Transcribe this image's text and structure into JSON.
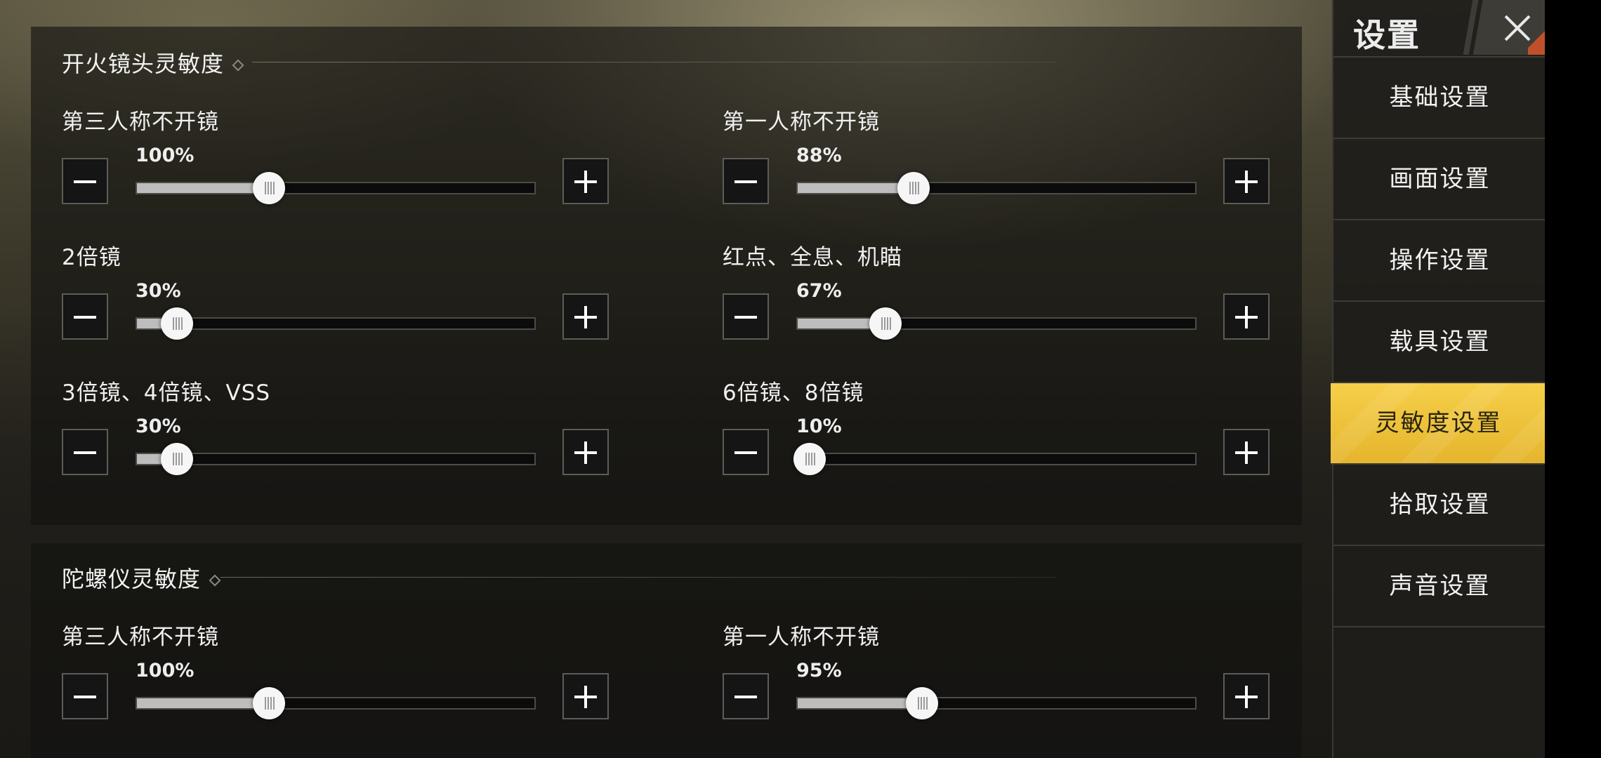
{
  "sidebar": {
    "title": "设置",
    "items": [
      {
        "label": "基础设置",
        "active": false
      },
      {
        "label": "画面设置",
        "active": false
      },
      {
        "label": "操作设置",
        "active": false
      },
      {
        "label": "载具设置",
        "active": false
      },
      {
        "label": "灵敏度设置",
        "active": true
      },
      {
        "label": "拾取设置",
        "active": false
      },
      {
        "label": "声音设置",
        "active": false
      }
    ]
  },
  "fire_scope": {
    "title": "开火镜头灵敏度",
    "controls": [
      {
        "label": "第三人称不开镜",
        "value_text": "100%",
        "level": 0.33
      },
      {
        "label": "第一人称不开镜",
        "value_text": "88%",
        "level": 0.29
      },
      {
        "label": "2倍镜",
        "value_text": "30%",
        "level": 0.1
      },
      {
        "label": "红点、全息、机瞄",
        "value_text": "67%",
        "level": 0.22
      },
      {
        "label": "3倍镜、4倍镜、VSS",
        "value_text": "30%",
        "level": 0.1
      },
      {
        "label": "6倍镜、8倍镜",
        "value_text": "10%",
        "level": 0.03
      }
    ]
  },
  "gyro": {
    "title": "陀螺仪灵敏度",
    "controls": [
      {
        "label": "第三人称不开镜",
        "value_text": "100%",
        "level": 0.33
      },
      {
        "label": "第一人称不开镜",
        "value_text": "95%",
        "level": 0.31
      }
    ]
  },
  "colors": {
    "accent": "#f2c43c",
    "track_fill": "#bdbdbd",
    "track_bg": "#0b0b0b"
  },
  "icons": {
    "minus": "minus-icon",
    "plus": "plus-icon",
    "close": "close-icon"
  }
}
